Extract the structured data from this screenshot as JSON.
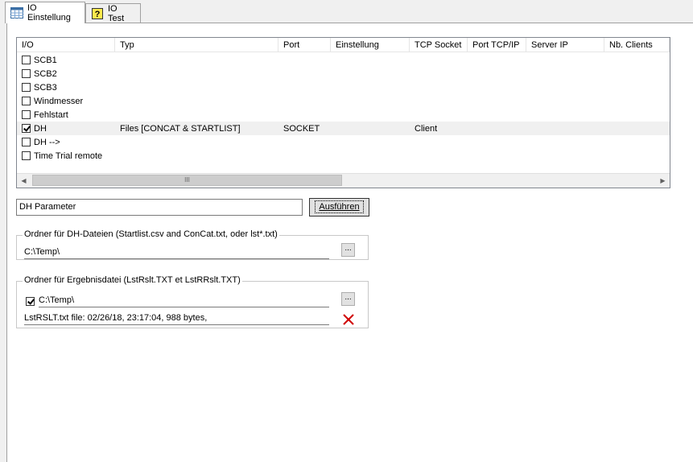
{
  "tabs": [
    {
      "label": "IO Einstellung",
      "icon": "table-icon",
      "active": true
    },
    {
      "label": "IO Test",
      "icon": "help-icon",
      "active": false
    }
  ],
  "io_list": {
    "columns": [
      "I/O",
      "Typ",
      "Port",
      "Einstellung",
      "TCP Socket",
      "Port TCP/IP",
      "Server IP",
      "Nb. Clients"
    ],
    "rows": [
      {
        "checked": false,
        "io": "SCB1",
        "typ": "",
        "port": "",
        "einstellung": "",
        "tcp_socket": "",
        "port_tcpip": "",
        "server_ip": "",
        "nb_clients": ""
      },
      {
        "checked": false,
        "io": "SCB2",
        "typ": "",
        "port": "",
        "einstellung": "",
        "tcp_socket": "",
        "port_tcpip": "",
        "server_ip": "",
        "nb_clients": ""
      },
      {
        "checked": false,
        "io": "SCB3",
        "typ": "",
        "port": "",
        "einstellung": "",
        "tcp_socket": "",
        "port_tcpip": "",
        "server_ip": "",
        "nb_clients": ""
      },
      {
        "checked": false,
        "io": "Windmesser",
        "typ": "",
        "port": "",
        "einstellung": "",
        "tcp_socket": "",
        "port_tcpip": "",
        "server_ip": "",
        "nb_clients": ""
      },
      {
        "checked": false,
        "io": "Fehlstart",
        "typ": "",
        "port": "",
        "einstellung": "",
        "tcp_socket": "",
        "port_tcpip": "",
        "server_ip": "",
        "nb_clients": ""
      },
      {
        "checked": true,
        "io": "DH",
        "typ": "Files [CONCAT & STARTLIST]",
        "port": "SOCKET",
        "einstellung": "",
        "tcp_socket": "Client",
        "port_tcpip": "",
        "server_ip": "",
        "nb_clients": ""
      },
      {
        "checked": false,
        "io": "DH  -->",
        "typ": "",
        "port": "",
        "einstellung": "",
        "tcp_socket": "",
        "port_tcpip": "",
        "server_ip": "",
        "nb_clients": ""
      },
      {
        "checked": false,
        "io": "Time Trial remote",
        "typ": "",
        "port": "",
        "einstellung": "",
        "tcp_socket": "",
        "port_tcpip": "",
        "server_ip": "",
        "nb_clients": ""
      }
    ],
    "scroll_left": "◀",
    "scroll_right": "▶",
    "scroll_thumb_grip": "III"
  },
  "dh_parameter": {
    "value": "DH Parameter",
    "execute_label": "Ausführen"
  },
  "dh_files_group": {
    "legend": "Ordner für DH-Dateien (Startlist.csv and ConCat.txt, oder lst*.txt)",
    "path": "C:\\Temp\\",
    "browse_label": "..."
  },
  "result_group": {
    "legend": "Ordner für Ergebnisdatei (LstRslt.TXT et LstRRslt.TXT)",
    "enabled": true,
    "path": "C:\\Temp\\",
    "browse_label": "...",
    "status": "LstRSLT.txt file: 02/26/18, 23:17:04, 988 bytes,",
    "delete_icon": "delete-x-icon",
    "delete_color": "#d00000"
  }
}
